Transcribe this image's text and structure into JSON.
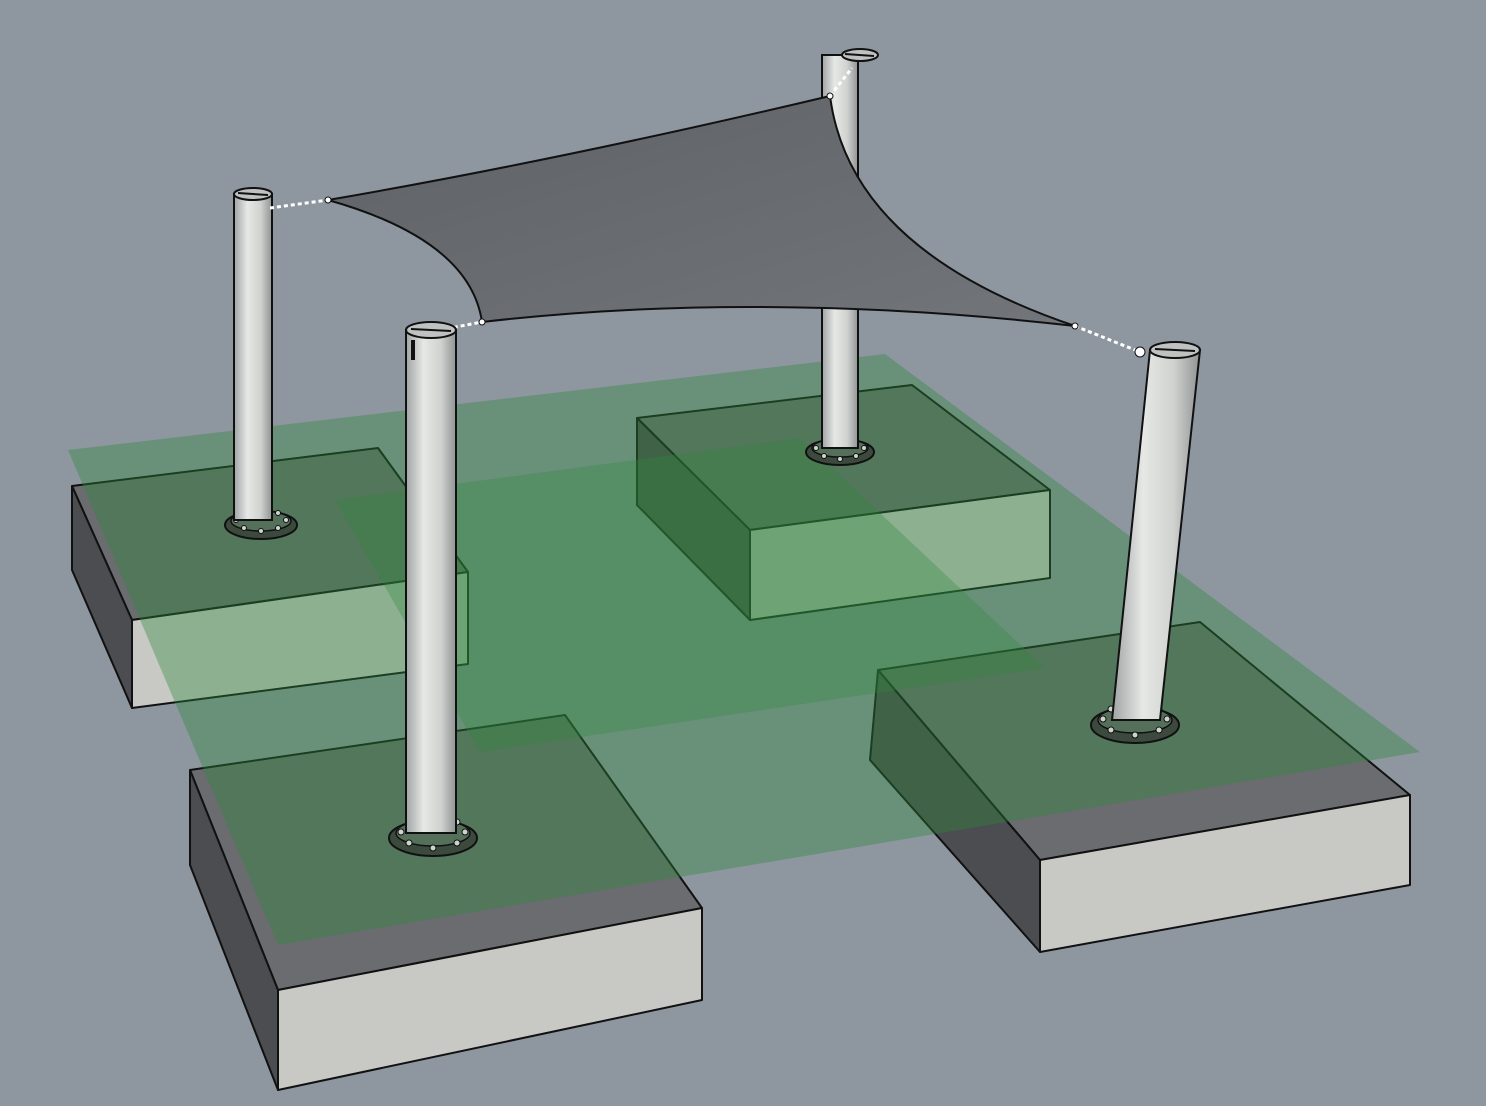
{
  "scene": {
    "kind": "3d-model-viewport",
    "render_style": "shaded",
    "colors": {
      "background": "#8e97a0",
      "concrete_top": "#6c6e70",
      "concrete_front": "#c9cac6",
      "concrete_side": "#4e4f52",
      "shade_sail": "#686c70",
      "ground_plane": "#2e8a3c",
      "post": "#cfd1cf",
      "edge_lines": "#111111"
    },
    "objects": {
      "shade_sail": "shade-sail",
      "posts": [
        "post-back-left",
        "post-front-left",
        "post-back-right",
        "post-front-right"
      ],
      "footings": [
        "footing-back-left",
        "footing-front-left",
        "footing-back-right",
        "footing-front-right"
      ],
      "ground_plane": "ground-plane"
    }
  }
}
